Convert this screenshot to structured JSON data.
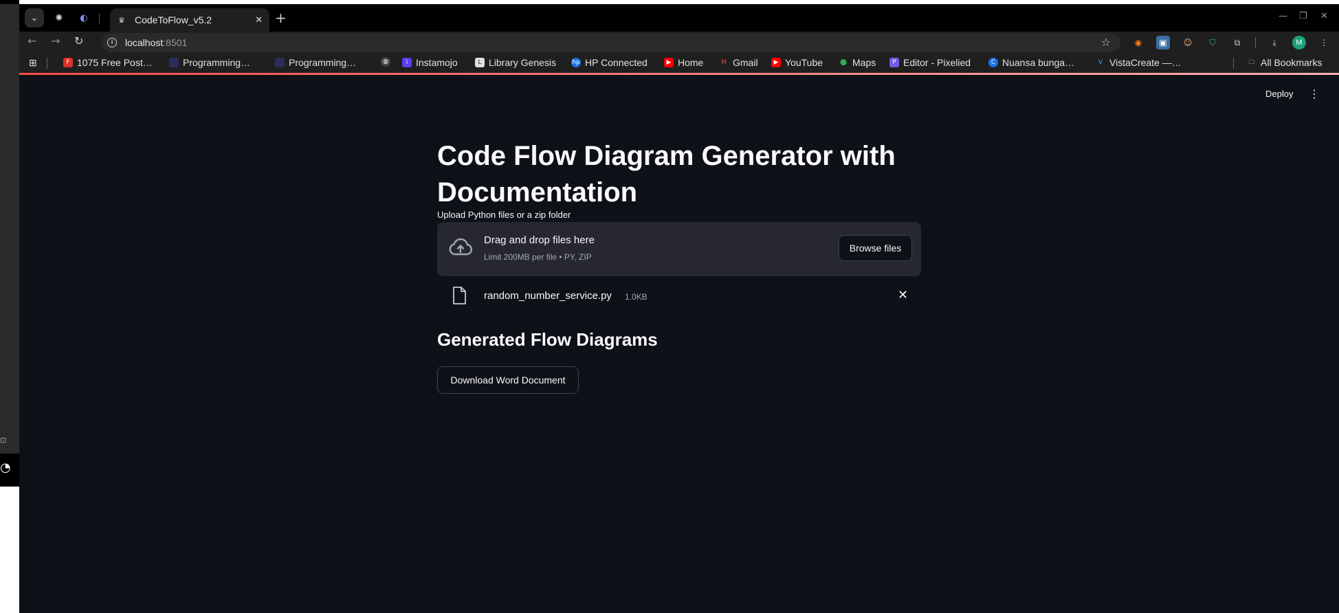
{
  "browser": {
    "active_tab_title": "CodeToFlow_v5.2",
    "new_tab_icon": "plus-icon",
    "url_host": "localhost",
    "url_port": ":8501",
    "profile_initial": "M",
    "bookmarks": [
      {
        "label": "1075 Free Post…",
        "icon_color": "#d93025",
        "icon_char": "F"
      },
      {
        "label": "Programming…",
        "icon_color": "#2a2d5a",
        "icon_char": ""
      },
      {
        "label": "Programming…",
        "icon_color": "#2a2d5a",
        "icon_char": ""
      },
      {
        "label": "",
        "icon_color": "#444",
        "icon_char": "◍"
      },
      {
        "label": "Instamojo",
        "icon_color": "#5b3df5",
        "icon_char": "i"
      },
      {
        "label": "Library Genesis",
        "icon_color": "#e0e0e0",
        "icon_char": "L"
      },
      {
        "label": "HP Connected",
        "icon_color": "#1a73e8",
        "icon_char": "hp"
      },
      {
        "label": "Home",
        "icon_color": "#ff0000",
        "icon_char": "▶"
      },
      {
        "label": "Gmail",
        "icon_color": "#1f1f1f",
        "icon_char": "M"
      },
      {
        "label": "YouTube",
        "icon_color": "#ff0000",
        "icon_char": "▶"
      },
      {
        "label": "Maps",
        "icon_color": "#1f1f1f",
        "icon_char": "⬤"
      },
      {
        "label": "Editor - Pixelied",
        "icon_color": "#6c5ce7",
        "icon_char": "P"
      },
      {
        "label": "Nuansa bunga…",
        "icon_color": "#1a73e8",
        "icon_char": "C"
      },
      {
        "label": "VistaCreate —…",
        "icon_color": "#1f1f1f",
        "icon_char": "V"
      }
    ],
    "all_bookmarks_label": "All Bookmarks",
    "accent_color": "#ff4b4b"
  },
  "app": {
    "deploy_label": "Deploy",
    "title": "Code Flow Diagram Generator with Documentation",
    "upload_label": "Upload Python files or a zip folder",
    "dropzone_title": "Drag and drop files here",
    "dropzone_limit": "Limit 200MB per file • PY, ZIP",
    "browse_label": "Browse files",
    "uploaded_file": {
      "name": "random_number_service.py",
      "size": "1.0KB"
    },
    "section_title": "Generated Flow Diagrams",
    "download_label": "Download Word Document",
    "background_color": "#0e1117",
    "surface_color": "#262730"
  }
}
